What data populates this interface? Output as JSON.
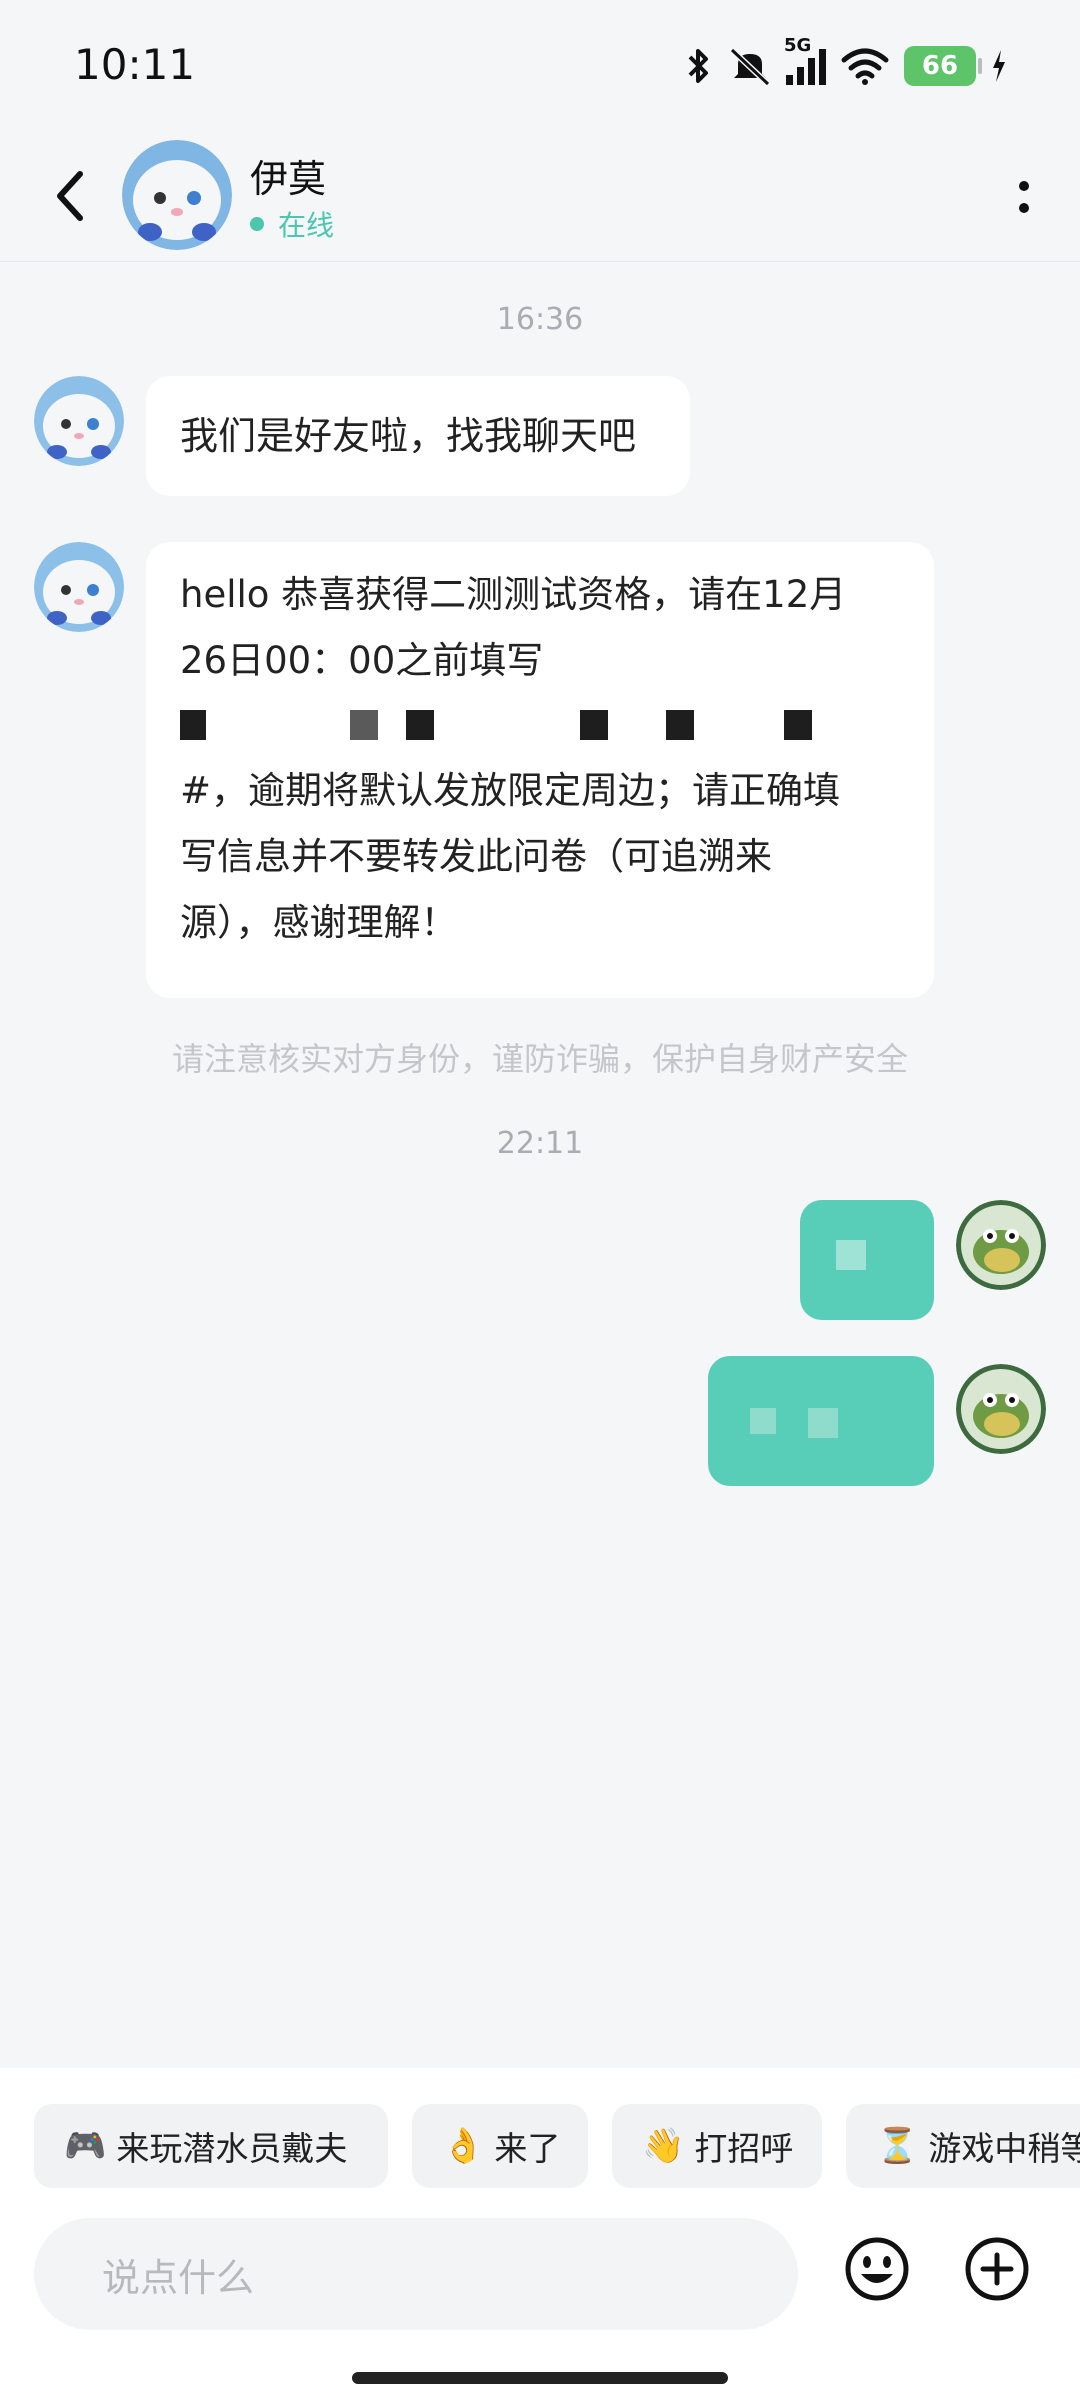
{
  "status_bar": {
    "time": "10:11",
    "signal_label": "5G",
    "battery": "66"
  },
  "header": {
    "name": "伊莫",
    "status": "在线"
  },
  "chat": {
    "time1": "16:36",
    "msg1": "我们是好友啦，找我聊天吧",
    "msg2_line1": "hello 恭喜获得二测测试资格，请在12月",
    "msg2_line2": "26日00：00之前填写",
    "msg2_line4": "#，逾期将默认发放限定周边；请正确填",
    "msg2_line5": "写信息并不要转发此问卷（可追溯来",
    "msg2_line6": "源），感谢理解！",
    "notice": "请注意核实对方身份，谨防诈骗，保护自身财产安全",
    "time2": "22:11"
  },
  "quick_replies": [
    {
      "emoji": "🎮",
      "label": "来玩潜水员戴夫"
    },
    {
      "emoji": "👌",
      "label": "来了"
    },
    {
      "emoji": "👋",
      "label": "打招呼"
    },
    {
      "emoji": "⏳",
      "label": "游戏中稍等"
    }
  ],
  "input": {
    "placeholder": "说点什么"
  },
  "colors": {
    "accent": "#58cdb8",
    "online": "#4bc7b0",
    "background": "#f5f6f8"
  }
}
